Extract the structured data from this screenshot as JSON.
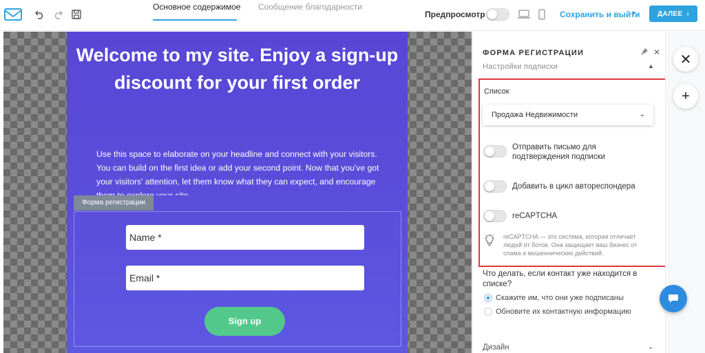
{
  "topbar": {
    "tabs": [
      {
        "label": "Основное содержимое",
        "active": true
      },
      {
        "label": "Сообщение благодарности",
        "active": false
      }
    ],
    "preview_label": "Предпросмотр",
    "save_exit_label": "Сохранить и выйти",
    "next_label": "ДАЛЕЕ",
    "icons": [
      "logo-envelope-icon",
      "undo-icon",
      "redo-icon",
      "save-icon",
      "desktop-icon",
      "mobile-icon"
    ]
  },
  "canvas": {
    "headline": "Welcome to my site. Enjoy a sign-up discount for your first order",
    "body": "Use this space to elaborate on your headline and connect with your visitors. You can build on the first idea or add your second point. Now that you've got your visitors' attention, let them know what they can expect, and encourage them to explore your site.",
    "form_tag": "Форма регистрации",
    "fields": {
      "name_placeholder": "Name *",
      "email_placeholder": "Email *"
    },
    "signup_label": "Sign up",
    "colors": {
      "background": "#5a4fdc",
      "button": "#52c98b"
    }
  },
  "panel": {
    "title": "ФОРМА РЕГИСТРАЦИИ",
    "subtitle": "Настройки подписки",
    "list_label": "Список",
    "list_value": "Продажа Недвижимости",
    "options": [
      {
        "label": "Отправить письмо для подтверждения подписки",
        "on": false
      },
      {
        "label": "Добавить в цикл автореспондера",
        "on": false
      },
      {
        "label": "reCAPTCHA",
        "on": false
      }
    ],
    "recaptcha_hint": "reCAPTCHA — это система, которая отличает людей от ботов. Она защищает ваш бизнес от спама и мошеннических действий.",
    "question": "Что делать, если контакт уже находится в списке?",
    "radios": [
      {
        "label": "Скажите им, что они уже подписаны",
        "checked": true
      },
      {
        "label": "Обновите их контактную информацию",
        "checked": false
      }
    ],
    "design_label": "Дизайн",
    "highlight_color": "#e0353b"
  },
  "accent_color": "#2da3e0"
}
